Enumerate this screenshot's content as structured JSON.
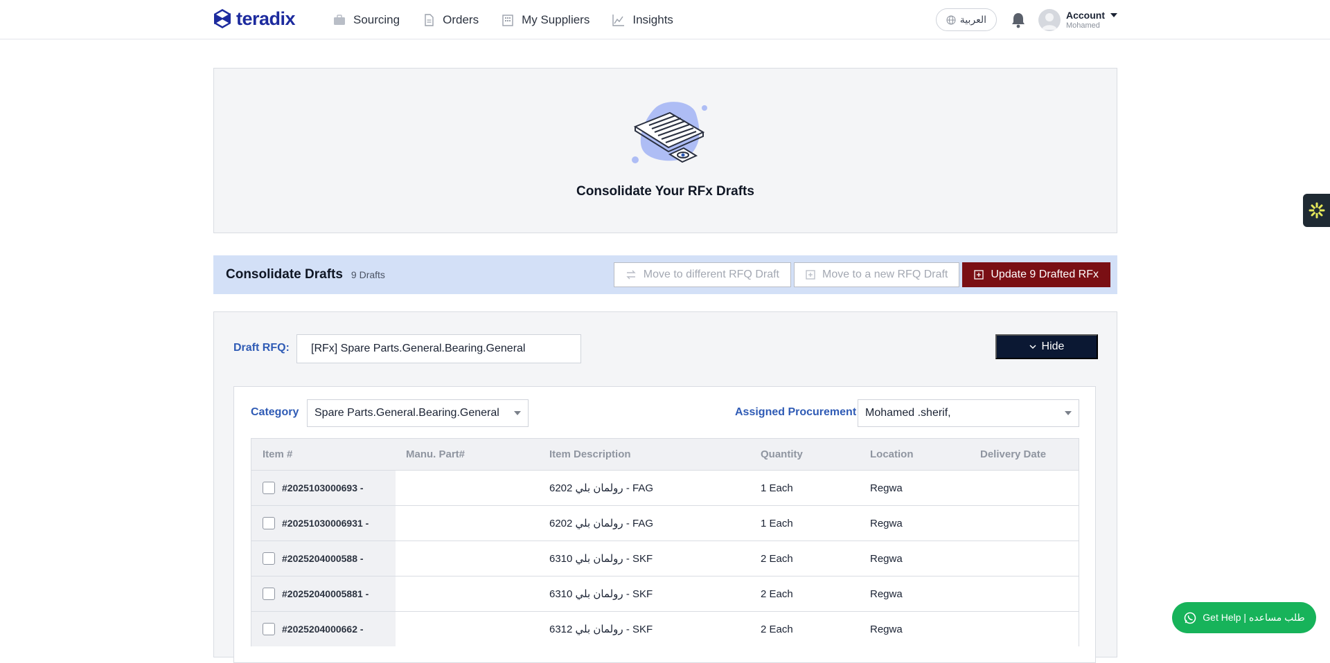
{
  "brand": {
    "name": "teradix"
  },
  "nav": {
    "items": [
      {
        "label": "Sourcing",
        "icon": "briefcase-icon"
      },
      {
        "label": "Orders",
        "icon": "document-icon"
      },
      {
        "label": "My Suppliers",
        "icon": "building-icon"
      },
      {
        "label": "Insights",
        "icon": "chart-line-icon"
      }
    ],
    "language_label": "العربية",
    "account_label": "Account",
    "account_user": "Mohamed"
  },
  "hero": {
    "caption": "Consolidate Your RFx Drafts"
  },
  "consolidate": {
    "title": "Consolidate Drafts",
    "count": "9 Drafts",
    "move_different_label": "Move to different RFQ Draft",
    "move_new_label": "Move to a new RFQ Draft",
    "update_label": "Update 9 Drafted RFx"
  },
  "draft": {
    "label": "Draft RFQ:",
    "value": "[RFx] Spare Parts.General.Bearing.General",
    "hide_label": "Hide",
    "category_label": "Category",
    "category_value": "Spare Parts.General.Bearing.General",
    "assigned_label": "Assigned Procurement",
    "assigned_value": "Mohamed .sherif,"
  },
  "table": {
    "headers": [
      "Item #",
      "Manu. Part#",
      "Item Description",
      "Quantity",
      "Location",
      "Delivery Date"
    ],
    "rows": [
      {
        "item": "#2025103000693 -",
        "part": "",
        "desc": "6202 رولمان بلي - FAG",
        "qty": "1 Each",
        "loc": "Regwa",
        "date": ""
      },
      {
        "item": "#20251030006931 -",
        "part": "",
        "desc": "6202 رولمان بلي - FAG",
        "qty": "1 Each",
        "loc": "Regwa",
        "date": ""
      },
      {
        "item": "#2025204000588 -",
        "part": "",
        "desc": "6310 رولمان بلي - SKF",
        "qty": "2 Each",
        "loc": "Regwa",
        "date": ""
      },
      {
        "item": "#20252040005881 -",
        "part": "",
        "desc": "6310 رولمان بلي - SKF",
        "qty": "2 Each",
        "loc": "Regwa",
        "date": ""
      },
      {
        "item": "#2025204000662 -",
        "part": "",
        "desc": "6312 رولمان بلي - SKF",
        "qty": "2 Each",
        "loc": "Regwa",
        "date": ""
      }
    ]
  },
  "help": {
    "label": "Get Help | طلب مساعده"
  },
  "colors": {
    "brand": "#1d2b9e",
    "accent_blue": "#2f5bb5",
    "danger": "#7a0f14",
    "navy": "#0b1833",
    "whatsapp": "#17b35a"
  }
}
